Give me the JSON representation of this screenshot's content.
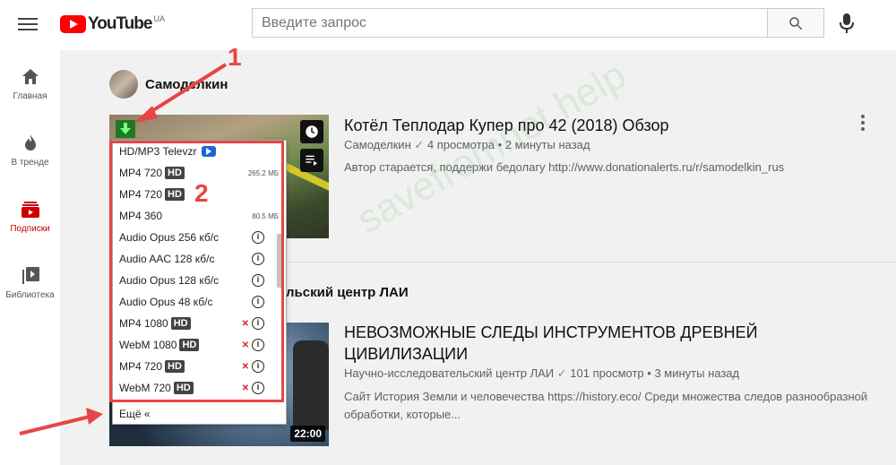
{
  "header": {
    "logo_text": "YouTube",
    "region": "UA",
    "search_placeholder": "Введите запрос"
  },
  "sidebar": {
    "items": [
      {
        "label": "Главная",
        "icon": "home-icon"
      },
      {
        "label": "В тренде",
        "icon": "fire-icon"
      },
      {
        "label": "Подписки",
        "icon": "subscriptions-icon",
        "active": true
      },
      {
        "label": "Библиотека",
        "icon": "library-icon"
      }
    ]
  },
  "feed": {
    "channel1": "Самоделкин",
    "channel2_partial": "льский центр ЛАИ",
    "video1": {
      "title": "Котёл Теплодар Купер про 42 (2018) Обзор",
      "channel": "Самоделкин",
      "views": "4 просмотра",
      "age": "2 минуты назад",
      "description": "Автор старается, поддержи бедолагу http://www.donationalerts.ru/r/samodelkin_rus"
    },
    "video2": {
      "title_line1": "НЕВОЗМОЖНЫЕ СЛЕДЫ ИНСТРУМЕНТОВ ДРЕВНЕЙ",
      "title_line2": "ЦИВИЛИЗАЦИИ",
      "channel": "Научно-исследовательский центр ЛАИ",
      "views": "101 просмотр",
      "age": "3 минуты назад",
      "desc_line1": "Сайт История Земли и человечества https://history.eco/ Среди множества следов разнообразной",
      "desc_line2": "обработки, которые...",
      "duration": "22:00"
    }
  },
  "dropdown": {
    "items": [
      {
        "label": "HD/MP3 Televzr",
        "hd": false,
        "size": "",
        "info": false,
        "mute": false,
        "televzr": true
      },
      {
        "label": "MP4 720",
        "hd": true,
        "size": "265.2 МБ",
        "info": false,
        "mute": false
      },
      {
        "label": "MP4 720",
        "hd": true,
        "size": "",
        "info": false,
        "mute": false
      },
      {
        "label": "MP4 360",
        "hd": false,
        "size": "80.5 МБ",
        "info": false,
        "mute": false
      },
      {
        "label": "Audio Opus 256 кб/с",
        "hd": false,
        "size": "",
        "info": true,
        "mute": false
      },
      {
        "label": "Audio AAC 128 кб/с",
        "hd": false,
        "size": "",
        "info": true,
        "mute": false
      },
      {
        "label": "Audio Opus 128 кб/с",
        "hd": false,
        "size": "",
        "info": true,
        "mute": false
      },
      {
        "label": "Audio Opus 48 кб/с",
        "hd": false,
        "size": "",
        "info": true,
        "mute": false
      },
      {
        "label": "MP4 1080",
        "hd": true,
        "size": "",
        "info": true,
        "mute": true
      },
      {
        "label": "WebM 1080",
        "hd": true,
        "size": "",
        "info": true,
        "mute": true
      },
      {
        "label": "MP4 720",
        "hd": true,
        "size": "",
        "info": true,
        "mute": true
      },
      {
        "label": "WebM 720",
        "hd": true,
        "size": "",
        "info": true,
        "mute": true
      }
    ],
    "hd_badge": "HD",
    "info_glyph": "i",
    "mute_glyph": "✕",
    "more_label": "Ещё «"
  },
  "annotations": {
    "callout1": "1",
    "callout2": "2",
    "watermark": "savefromnet.help"
  },
  "colors": {
    "accent_red": "#ff0000",
    "annotation_red": "#e84545",
    "download_green": "#1e7a1e"
  }
}
